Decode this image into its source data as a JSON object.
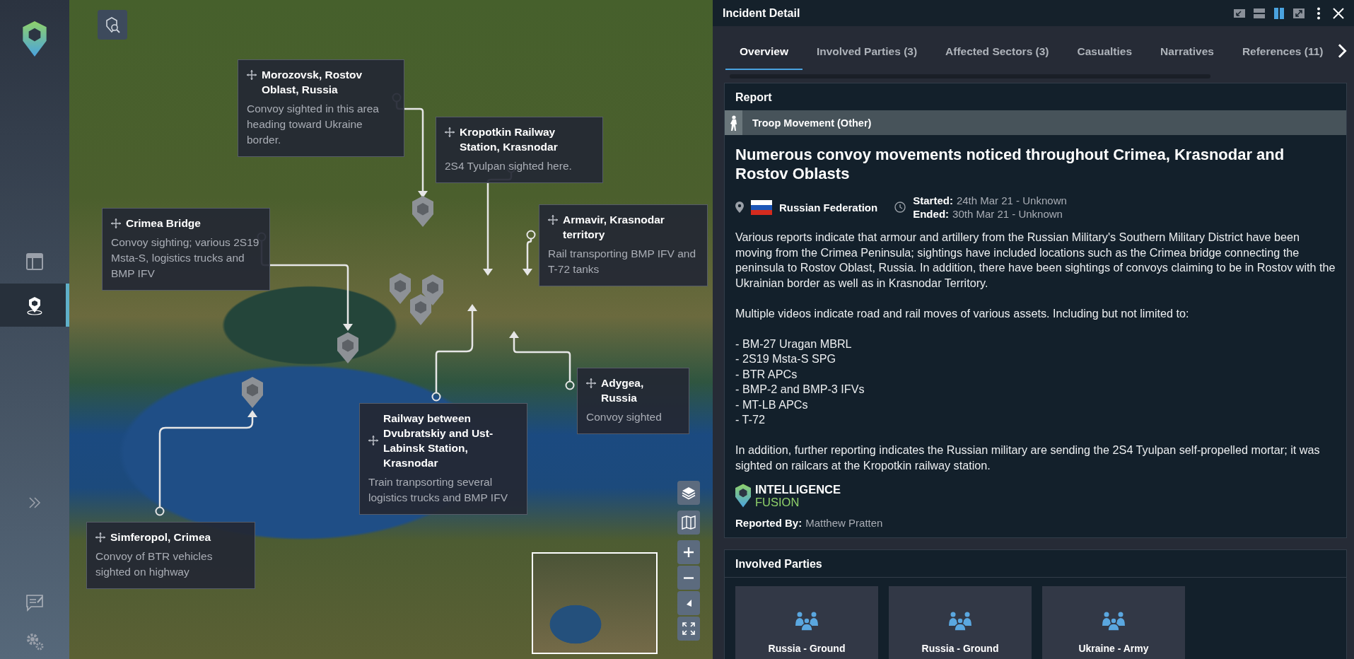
{
  "sidebar": {
    "items": [
      {
        "kind": "dashboard",
        "selected": false
      },
      {
        "kind": "map",
        "selected": true
      }
    ]
  },
  "map": {
    "callouts": [
      {
        "title": "Morozovsk, Rostov Oblast, Russia",
        "description": "Convoy sighted in this area heading toward Ukraine border."
      },
      {
        "title": "Kropotkin Railway Station, Krasnodar",
        "description": "2S4 Tyulpan sighted here."
      },
      {
        "title": "Crimea Bridge",
        "description": "Convoy sighting; various 2S19 Msta-S, logistics trucks and BMP IFV"
      },
      {
        "title": "Armavir, Krasnodar territory",
        "description": "Rail transporting BMP IFV and T-72 tanks"
      },
      {
        "title": "Adygea, Russia",
        "description": "Convoy sighted"
      },
      {
        "title": "Railway between Dvubratskiy and Ust-Labinsk Station, Krasnodar",
        "description": "Train tranpsorting several logistics trucks and BMP IFV"
      },
      {
        "title": "Simferopol, Crimea",
        "description": "Convoy of BTR vehicles sighted on highway"
      }
    ]
  },
  "panel": {
    "title": "Incident Detail",
    "layout_buttons": [
      {
        "kind": "minimize",
        "selected": false
      },
      {
        "kind": "stacked",
        "selected": false
      },
      {
        "kind": "split",
        "selected": true
      },
      {
        "kind": "expand",
        "selected": false
      }
    ],
    "tabs": [
      {
        "label": "Overview",
        "selected": true
      },
      {
        "label": "Involved Parties (3)",
        "selected": false
      },
      {
        "label": "Affected Sectors (3)",
        "selected": false
      },
      {
        "label": "Casualties",
        "selected": false
      },
      {
        "label": "Narratives",
        "selected": false
      },
      {
        "label": "References (11)",
        "selected": false
      }
    ],
    "report": {
      "heading": "Report",
      "category": "Troop Movement (Other)",
      "title": "Numerous convoy movements noticed throughout Crimea, Krasnodar and Rostov Oblasts",
      "country": "Russian Federation",
      "started_label": "Started:",
      "started": "24th Mar 21 - Unknown",
      "ended_label": "Ended:",
      "ended": "30th Mar 21 - Unknown",
      "paragraphs": [
        "Various reports indicate that armour and artillery from the Russian Military's Southern Military District have been moving from the Crimea Peninsula; sightings have included locations such as the Crimea bridge connecting the peninsula to Rostov Oblast, Russia. In addition, there have been sightings of convoys claiming to be in Rostov with the Ukrainian border as well as in Krasnodar Territory.",
        "Multiple videos indicate road and rail moves of various assets. Including but not limited to:"
      ],
      "list": [
        "- BM-27 Uragan MBRL",
        "- 2S19 Msta-S SPG",
        "- BTR APCs",
        "- BMP-2 and BMP-3 IFVs",
        "- MT-LB APCs",
        "- T-72"
      ],
      "closing": "In addition, further reporting indicates the Russian military are sending the 2S4 Tyulpan self-propelled mortar; it was sighted on railcars at the Kropotkin railway station.",
      "source_logo": [
        "INTELLIGENCE",
        "FUSION"
      ],
      "reported_by_label": "Reported By:",
      "reported_by": "Matthew Pratten"
    },
    "involved_parties": {
      "heading": "Involved Parties",
      "parties": [
        "Russia - Ground",
        "Russia - Ground",
        "Ukraine - Army"
      ]
    }
  }
}
